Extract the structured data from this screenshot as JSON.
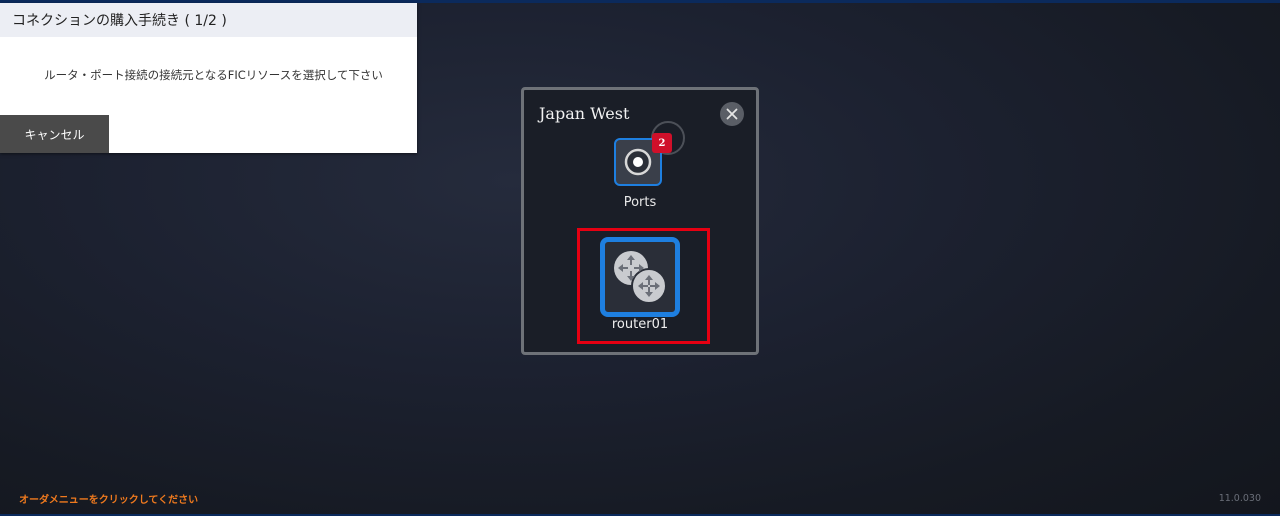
{
  "wizard": {
    "title": "コネクションの購入手続き ( 1/2 )",
    "message": "ルータ・ポート接続の接続元となるFICリソースを選択して下さい",
    "cancel_label": "キャンセル"
  },
  "region": {
    "title": "Japan West",
    "ports": {
      "label": "Ports",
      "badge": "2",
      "icon": "port-icon"
    },
    "router": {
      "label": "router01",
      "icon": "router-icon",
      "highlight_color": "#e60012"
    },
    "close_icon": "close-icon"
  },
  "footer": {
    "order_hint": "オーダメニューをクリックしてください",
    "version": "11.0.030"
  },
  "colors": {
    "accent_blue": "#1e7fe0",
    "badge_red": "#d0102a",
    "hint_orange": "#f07a1e"
  }
}
